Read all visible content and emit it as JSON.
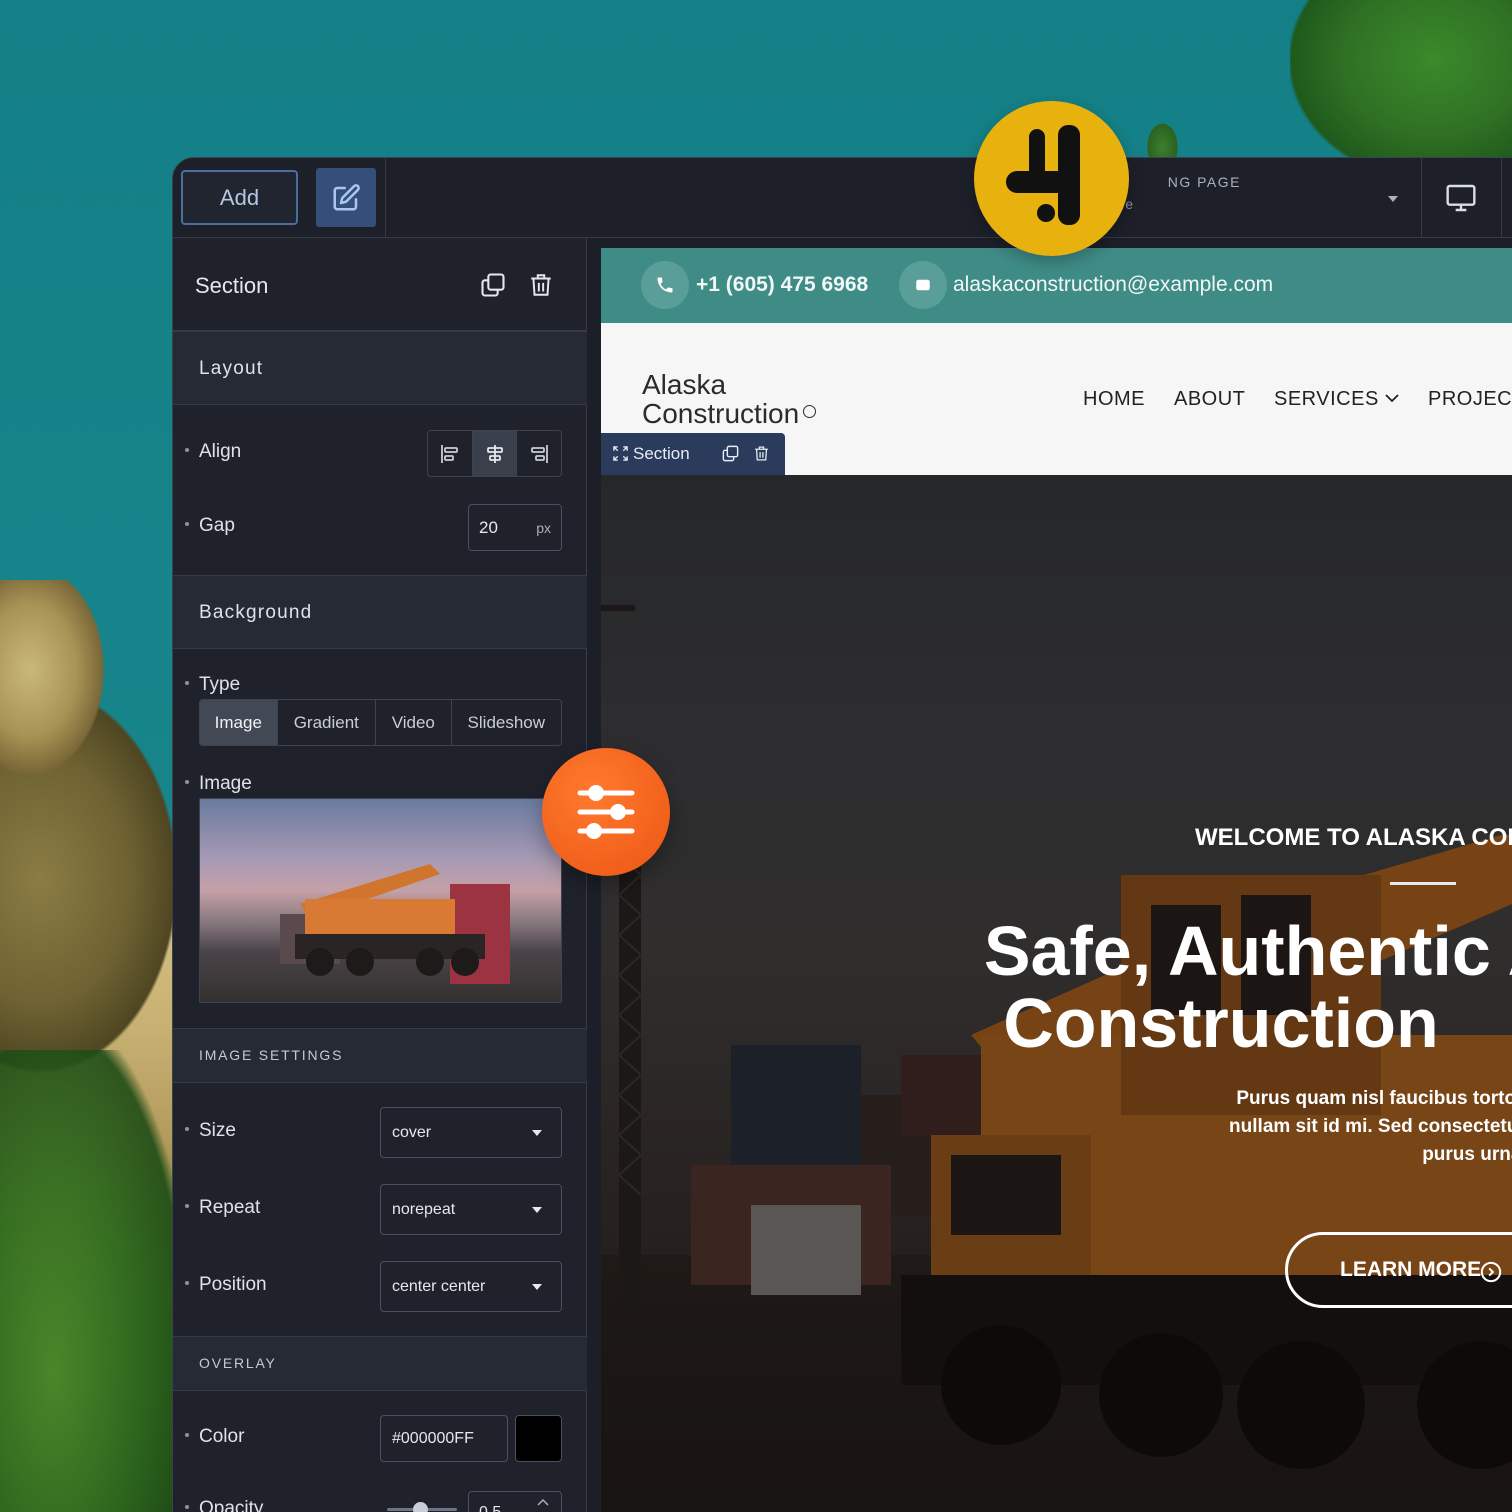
{
  "toolbar": {
    "add_label": "Add",
    "edit_icon": "edit-icon",
    "page_label": "NG PAGE",
    "page_sub": "e",
    "device_icon": "monitor-icon"
  },
  "panel": {
    "title": "Section",
    "layout": {
      "heading": "Layout",
      "align_label": "Align",
      "align_options": [
        "align-left",
        "align-center",
        "align-right"
      ],
      "align_selected": "align-center",
      "gap_label": "Gap",
      "gap_value": "20",
      "gap_unit": "px"
    },
    "background": {
      "heading": "Background",
      "type_label": "Type",
      "type_tabs": [
        "Image",
        "Gradient",
        "Video",
        "Slideshow"
      ],
      "type_selected": "Image",
      "image_label": "Image"
    },
    "image_settings": {
      "heading": "IMAGE SETTINGS",
      "size_label": "Size",
      "size_value": "cover",
      "repeat_label": "Repeat",
      "repeat_value": "norepeat",
      "position_label": "Position",
      "position_value": "center center"
    },
    "overlay": {
      "heading": "OVERLAY",
      "color_label": "Color",
      "color_value": "#000000FF",
      "swatch_color": "#000000",
      "opacity_label": "Opacity",
      "opacity_value": "0.5"
    }
  },
  "preview": {
    "topbar": {
      "phone": "+1 (605) 475 6968",
      "email": "alaskaconstruction@example.com"
    },
    "logo_line1": "Alaska",
    "logo_line2": "Construction",
    "nav": [
      "HOME",
      "ABOUT",
      "SERVICES",
      "PROJEC"
    ],
    "section_tag": "Section",
    "hero": {
      "eyebrow": "WELCOME TO ALASKA CON",
      "title_line1": "Safe, Authentic A",
      "title_line2": "Construction",
      "desc_line1": "Purus quam nisl faucibus tortor ac felis vestibu",
      "desc_line2": "nullam sit id mi. Sed consectetur libero aliquam fa",
      "desc_line3": "purus urna turpis leo dolor",
      "button": "LEARN MORE"
    }
  },
  "colors": {
    "accent_teal": "#3f8c87",
    "panel_bg": "#1f222b",
    "badge_yellow": "#e8b20e",
    "badge_orange": "#f2601b"
  }
}
